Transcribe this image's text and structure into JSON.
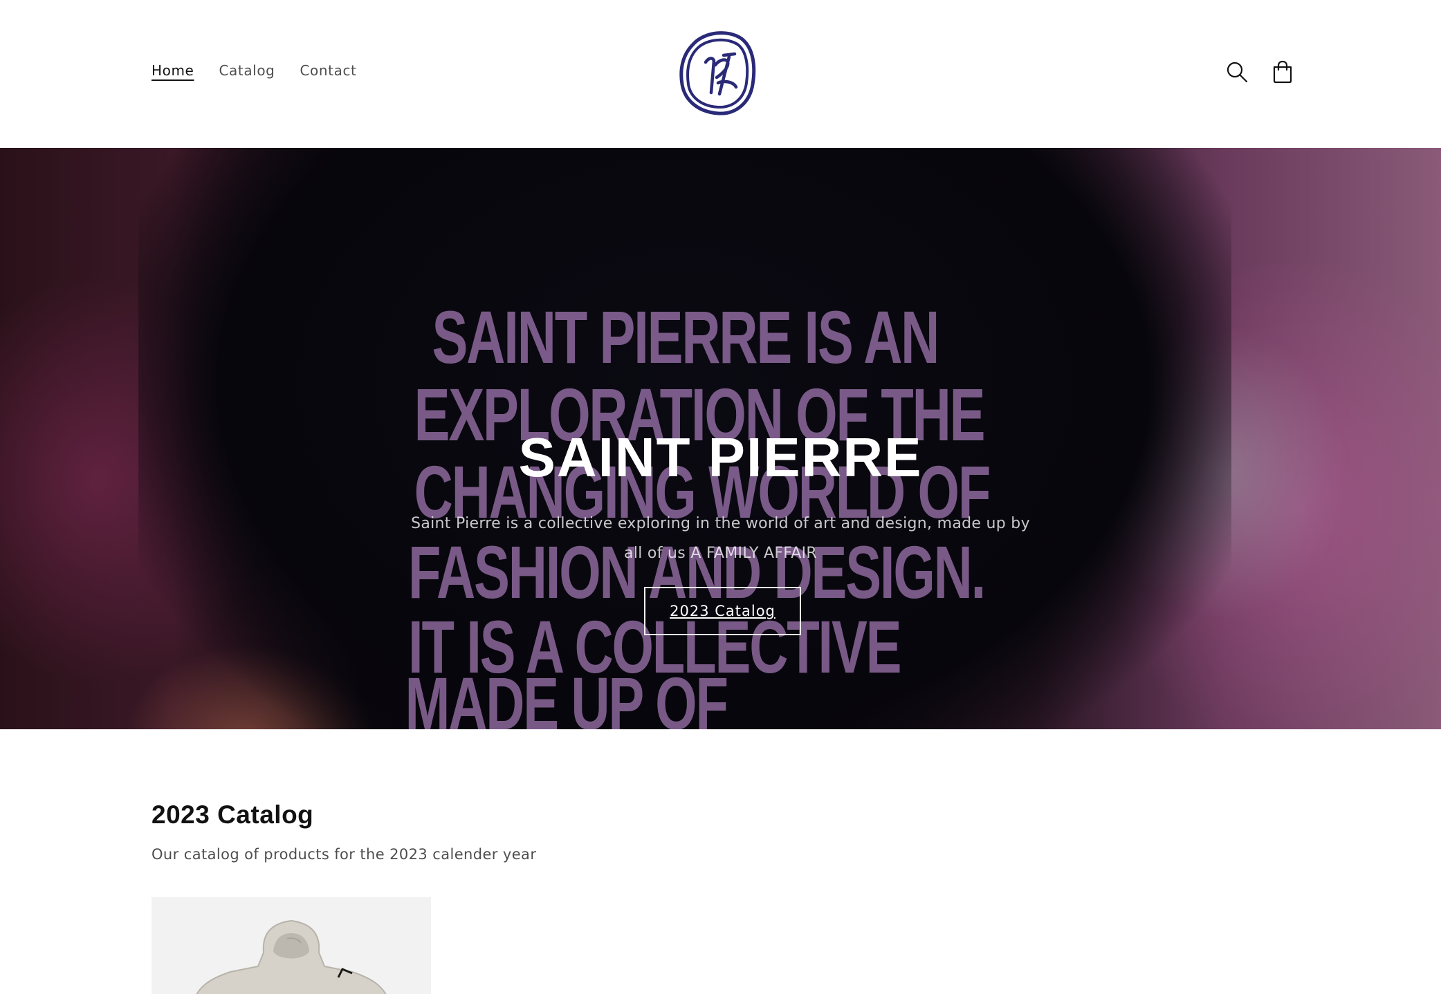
{
  "header": {
    "nav": [
      {
        "label": "Home",
        "active": true
      },
      {
        "label": "Catalog",
        "active": false
      },
      {
        "label": "Contact",
        "active": false
      }
    ],
    "logo_icon": "saint-pierre-logo",
    "icons": [
      "search-icon",
      "cart-icon"
    ],
    "logo_color": "#2a2a78"
  },
  "hero": {
    "title": "SAINT PIERRE",
    "text": "Saint Pierre is a collective exploring in the world of art and design, made up by all of us A FAMILY AFFAIR",
    "button_label": "2023 Catalog",
    "background_print": [
      "SAINT PIERRE IS AN",
      "EXPLORATION OF THE",
      "CHANGING WORLD OF",
      "FASHION AND DESIGN.",
      "IT IS A COLLECTIVE",
      "MADE UP OF"
    ]
  },
  "catalog": {
    "title": "2023 Catalog",
    "description": "Our catalog of products for the 2023 calender year",
    "products": [
      {
        "image": "hoodie-product-image"
      }
    ]
  }
}
